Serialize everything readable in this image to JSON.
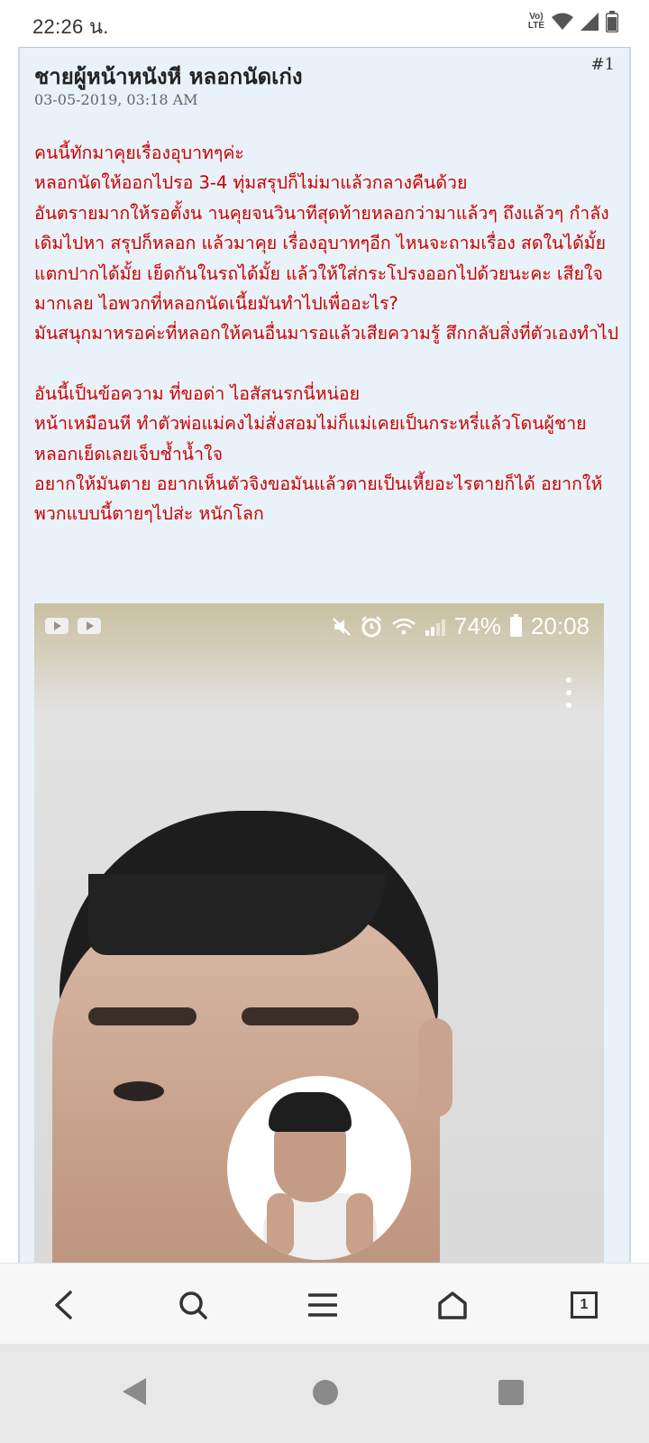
{
  "status_bar": {
    "time": "22:26 น.",
    "volte_label": "Vo)) LTE"
  },
  "post": {
    "number": "#1",
    "title": "ชายผู้หน้าหนังหี หลอกนัดเก่ง",
    "date": "03-05-2019, 03:18 AM",
    "body_lines": [
      "คนนี้ทักมาคุยเรื่องอุบาทๆค่ะ",
      "หลอกนัดให้ออกไปรอ 3-4 ทุ่มสรุปก็ไม่มาแล้วกลางคืนด้วย",
      "อันตรายมากให้รอตั้งน านคุยจนวินาทีสุดท้ายหลอกว่ามาแล้วๆ ถึงแล้วๆ กำลังเดิมไปหา สรุปก็หลอก แล้วมาคุย เรื่องอุบาทๆอีก ไหนจะถามเรื่อง สดในได้มั้ย แตกปากได้มั้ย เย็ดกันในรถได้มั้ย แล้วให้ใส่กระโปรงออกไปด้วยนะคะ เสียใจมากเลย ไอพวกที่หลอกนัดเนี้ยมันทำไปเพื่ออะไร?",
      "มันสนุกมาหรอค่ะที่หลอกให้คนอื่นมารอแล้วเสียความรู้ สึกกลับสิ่งที่ตัวเองทำไป"
    ],
    "body_lines_2": [
      "อันนี้เป็นข้อความ ที่ขอด่า ไอสัสนรกนี่หน่อย",
      "หน้าเหมือนหี ทำตัวพ่อแม่คงไม่สั่งสอมไม่ก็แม่เคยเป็นกระหรี่แล้วโดนผู้ชายหลอกเย็ดเลยเจ็บช้ำน้ำใจ",
      "อยากให้มันตาย อยากเห็นตัวจิงขอมันแล้วตายเป็นเหี้ยอะไรตายก็ได้ อยากให้พวกแบบนี้ตายๆไปส่ะ หนักโลก"
    ],
    "text_color": "#cc0000"
  },
  "embedded_screenshot": {
    "battery_percent": "74%",
    "time": "20:08"
  },
  "toolbar": {
    "tab_count": "1"
  }
}
